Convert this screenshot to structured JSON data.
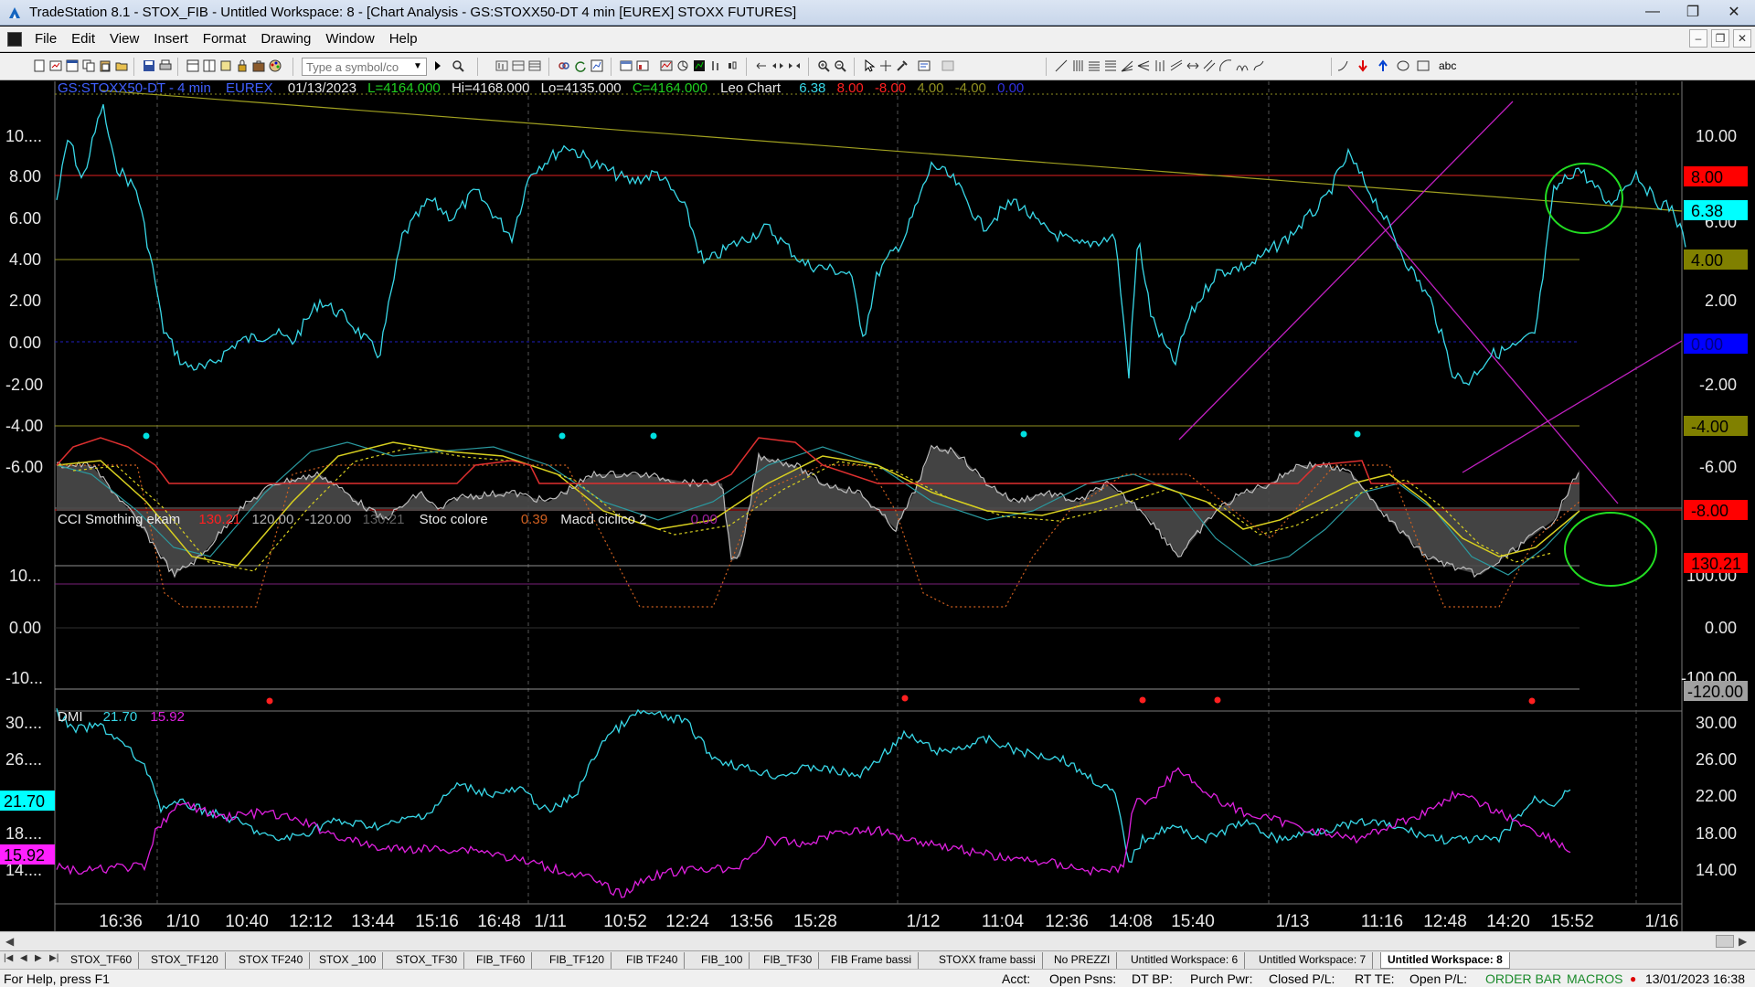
{
  "window": {
    "title": "TradeStation 8.1 - STOX_FIB - Untitled Workspace:  8 - [Chart Analysis - GS:STOXX50-DT  4 min  [EUREX] STOXX FUTURES]",
    "icon": "tradestation-icon"
  },
  "menu": [
    "File",
    "Edit",
    "View",
    "Insert",
    "Format",
    "Drawing",
    "Window",
    "Help"
  ],
  "toolbar": {
    "symbol_placeholder": "Type a symbol/co",
    "abc_label": "abc"
  },
  "chart": {
    "header": {
      "symbol": "GS:STOXX50-DT - 4 min",
      "exchange": "EUREX",
      "date": "01/13/2023",
      "last": "L=4164.000",
      "high": "Hi=4168.000",
      "low": "Lo=4135.000",
      "close": "C=4164.000",
      "study": "Leo Chart",
      "v1": "6.38",
      "v2": "8.00",
      "v3": "-8.00",
      "v4": "4.00",
      "v5": "-4.00",
      "v6": "0.00"
    },
    "price_axis_right": [
      "10.00",
      "8.00",
      "6.00",
      "4.00",
      "2.00",
      "0.00",
      "-2.00",
      "-4.00",
      "-6.00"
    ],
    "price_axis_left": [
      "10....",
      "8.00",
      "6.00",
      "4.00",
      "2.00",
      "0.00",
      "-2.00",
      "-4.00",
      "-6.00"
    ],
    "price_badges": [
      {
        "label": "8.00",
        "color": "#ff0000",
        "text_color": "#000000"
      },
      {
        "label": "6.38",
        "color": "#00ffff",
        "text_color": "#000000"
      },
      {
        "label": "4.00",
        "color": "#808000",
        "text_color": "#000000"
      },
      {
        "label": "0.00",
        "color": "#0000ff",
        "text_color": "#000080"
      },
      {
        "label": "-4.00",
        "color": "#808000",
        "text_color": "#000000"
      },
      {
        "label": "-8.00",
        "color": "#ff0000",
        "text_color": "#000000"
      }
    ],
    "cci": {
      "name": "CCI Smothing ekam",
      "v1": "130.21",
      "v2": "120.00",
      "v3": "-120.00",
      "v4": "130.21",
      "stoc_name": "Stoc colore",
      "stoc_value": "0.39",
      "macd_name": "Macd ciclico 2",
      "macd_value": "0.00",
      "axis_left": [
        "10...",
        "0.00",
        "-10..."
      ],
      "axis_right": [
        "100.00",
        "0.00",
        "-100.00"
      ],
      "badge_top": "130.21",
      "badge_bottom": "-120.00"
    },
    "dmi": {
      "name": "DMI",
      "plus": "21.70",
      "minus": "15.92",
      "axis_left": [
        "30....",
        "26....",
        "18....",
        "14...."
      ],
      "axis_right": [
        "30.00",
        "26.00",
        "22.00",
        "18.00",
        "14.00"
      ]
    },
    "time_axis": [
      "16:36",
      "1/10",
      "10:40",
      "12:12",
      "13:44",
      "15:16",
      "16:48",
      "1/11",
      "10:52",
      "12:24",
      "13:56",
      "15:28",
      "1/12",
      "11:04",
      "12:36",
      "14:08",
      "15:40",
      "1/13",
      "11:16",
      "12:48",
      "14:20",
      "15:52",
      "1/16"
    ],
    "colors": {
      "price": "#38d8e8",
      "dmi_plus": "#38d8e8",
      "dmi_minus": "#e020e0",
      "trendline": "#c020c0",
      "resistance": "#909020",
      "highlight": "#22dd22"
    }
  },
  "tabs": {
    "items": [
      "STOX_TF60",
      "STOX_TF120",
      "STOX TF240",
      "STOX _100",
      "STOX_TF30",
      "FIB_TF60",
      "FIB_TF120",
      "FIB TF240",
      "FIB_100",
      "FIB_TF30",
      "FIB Frame bassi",
      "STOXX frame bassi",
      "No PREZZI",
      "Untitled Workspace:  6",
      "Untitled Workspace:  7",
      "Untitled Workspace:  8"
    ],
    "active_index": 15
  },
  "status": {
    "help": "For Help, press F1",
    "acct": "Acct:",
    "open_psns": "Open Psns:",
    "dt_bp": "DT BP:",
    "purch_pwr": "Purch Pwr:",
    "closed_pl": "Closed P/L:",
    "rt_te": "RT TE:",
    "open_pl": "Open P/L:",
    "order_bar": "ORDER BAR",
    "macros": "MACROS",
    "datetime": "13/01/2023 16:38"
  }
}
